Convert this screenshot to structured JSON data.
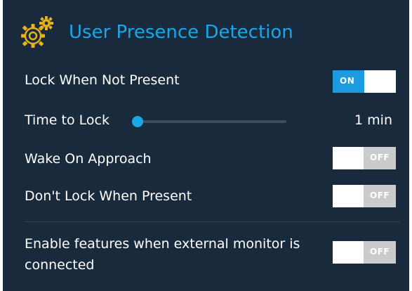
{
  "header": {
    "title": "User Presence Detection",
    "icon": "gears-icon",
    "accent_color": "#1aa7e8"
  },
  "settings": {
    "lock_when_not_present": {
      "label": "Lock When Not Present",
      "state": "ON"
    },
    "time_to_lock": {
      "label": "Time to Lock",
      "value": "1 min",
      "level": 0
    },
    "wake_on_approach": {
      "label": "Wake On Approach",
      "state": "OFF"
    },
    "dont_lock_when_present": {
      "label": "Don't Lock When Present",
      "state": "OFF"
    },
    "external_monitor": {
      "label": "Enable features when external monitor is connected",
      "state": "OFF"
    }
  },
  "colors": {
    "background": "#1a2a3d",
    "toggle_on": "#1c9be0",
    "toggle_off": "#c9cbcd"
  }
}
